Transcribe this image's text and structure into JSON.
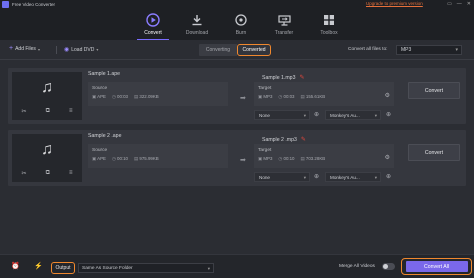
{
  "window": {
    "title": "Free Video Converter",
    "upgrade_link": "Upgrade to premium version",
    "controls": [
      "▭",
      "—",
      "✕"
    ]
  },
  "nav": {
    "tabs": [
      {
        "label": "Convert",
        "icon": "play-circle-icon",
        "active": true
      },
      {
        "label": "Download",
        "icon": "download-icon",
        "active": false
      },
      {
        "label": "Burn",
        "icon": "disc-icon",
        "active": false
      },
      {
        "label": "Transfer",
        "icon": "transfer-icon",
        "active": false
      },
      {
        "label": "Toolbox",
        "icon": "toolbox-icon",
        "active": false
      }
    ]
  },
  "toolbar": {
    "add_files": "Add Files",
    "load_dvd": "Load DVD",
    "segment": {
      "converting": "Converting",
      "converted": "Converted"
    },
    "convert_all_label": "Convert all files to:",
    "convert_all_format": "MP3"
  },
  "tasks": [
    {
      "source_name": "Sample 1.ape",
      "source_label": "Source",
      "source_format": "APE",
      "source_duration": "00:03",
      "source_size": "322.09KB",
      "target_name": "Sample 1.mp3",
      "target_label": "Target",
      "target_format": "MP3",
      "target_duration": "00:03",
      "target_size": "155.61KB",
      "subtitle": "None",
      "audio_track": "Monkey's Au...",
      "convert_label": "Convert"
    },
    {
      "source_name": "Sample 2 .ape",
      "source_label": "Source",
      "source_format": "APE",
      "source_duration": "00:10",
      "source_size": "975.99KB",
      "target_name": "Sample 2 .mp3",
      "target_label": "Target",
      "target_format": "MP3",
      "target_duration": "00:10",
      "target_size": "703.28KB",
      "subtitle": "None",
      "audio_track": "Monkey's Au...",
      "convert_label": "Convert"
    }
  ],
  "bottom": {
    "output_label": "Output",
    "output_path": "Same As Source Folder",
    "merge_label": "Merge All Videos",
    "merge_enabled": false,
    "convert_all_button": "Convert All"
  },
  "colors": {
    "accent": "#7a68ea",
    "highlight": "#f0882e",
    "edit": "#e2483d"
  }
}
